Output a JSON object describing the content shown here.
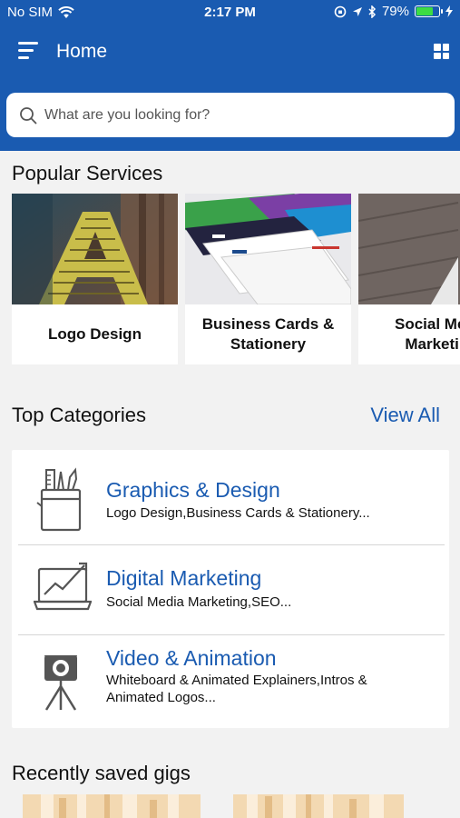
{
  "status": {
    "carrier": "No SIM",
    "time": "2:17 PM",
    "battery": "79%",
    "battery_level": 0.79
  },
  "nav": {
    "title": "Home"
  },
  "search": {
    "placeholder": "What are you looking for?"
  },
  "popular": {
    "title": "Popular Services",
    "items": [
      {
        "label": "Logo Design"
      },
      {
        "label": "Business Cards & Stationery"
      },
      {
        "label": "Social Media Marketing"
      }
    ]
  },
  "categories": {
    "title": "Top Categories",
    "view_all": "View All",
    "items": [
      {
        "title": "Graphics & Design",
        "subtitle": "Logo Design,Business Cards & Stationery..."
      },
      {
        "title": "Digital Marketing",
        "subtitle": "Social Media Marketing,SEO..."
      },
      {
        "title": "Video & Animation",
        "subtitle": "Whiteboard & Animated Explainers,Intros & Animated Logos..."
      }
    ]
  },
  "saved": {
    "title": "Recently saved gigs"
  },
  "colors": {
    "brand": "#1a5bb1",
    "background": "#f2f2f2"
  }
}
